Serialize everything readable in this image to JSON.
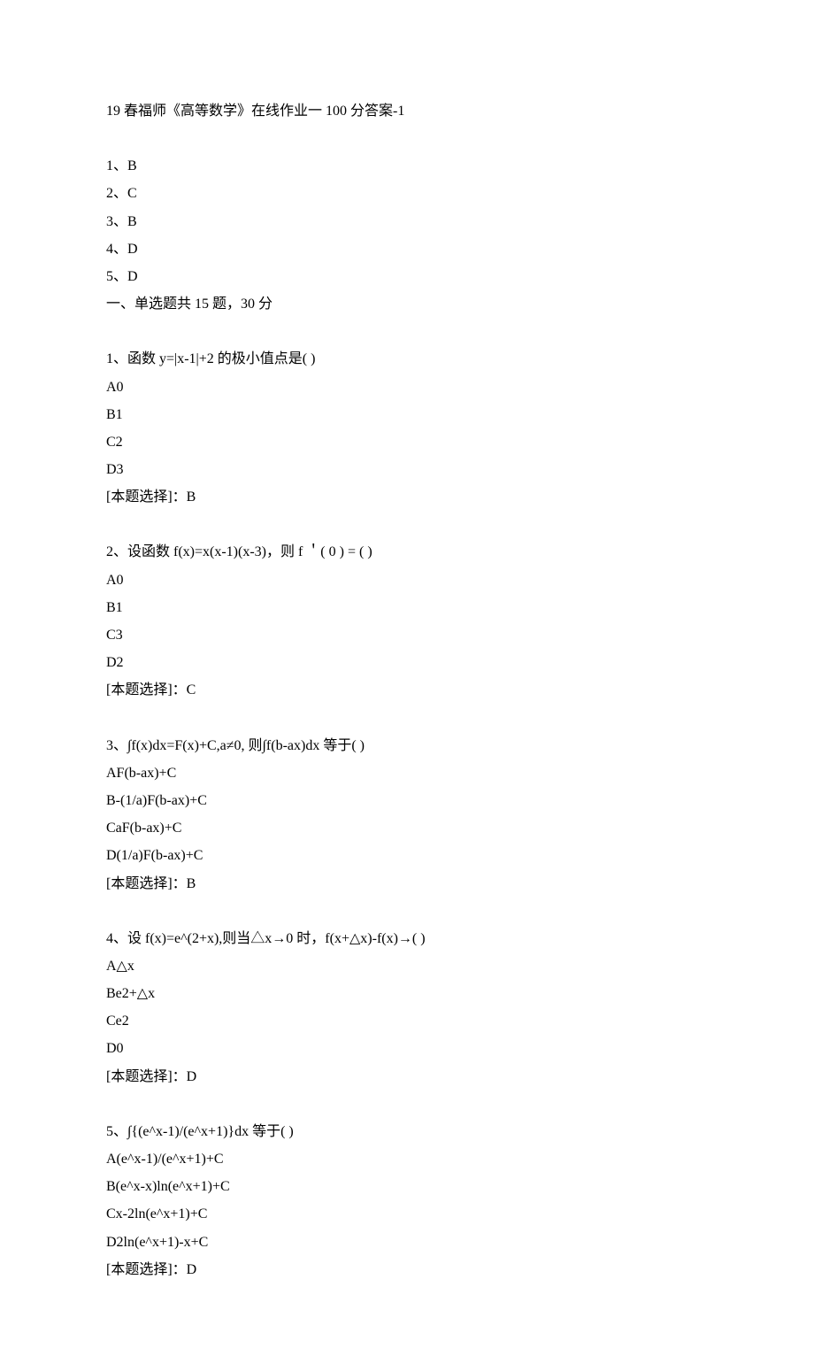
{
  "title": "19 春福师《高等数学》在线作业一 100 分答案-1",
  "answerKey": [
    "1、B",
    "2、C",
    "3、B",
    "4、D",
    "5、D"
  ],
  "sectionHeader": "一、单选题共 15 题，30 分",
  "questions": [
    {
      "prompt": "1、函数 y=|x-1|+2 的极小值点是( )",
      "options": [
        "A0",
        "B1",
        "C2",
        "D3"
      ],
      "answer": "[本题选择]：B"
    },
    {
      "prompt": "2、设函数 f(x)=x(x-1)(x-3)，则 f ＇( 0 ) = ( )",
      "options": [
        "A0",
        "B1",
        "C3",
        "D2"
      ],
      "answer": "[本题选择]：C"
    },
    {
      "prompt": "3、∫f(x)dx=F(x)+C,a≠0, 则∫f(b-ax)dx 等于( )",
      "options": [
        "AF(b-ax)+C",
        "B-(1/a)F(b-ax)+C",
        "CaF(b-ax)+C",
        "D(1/a)F(b-ax)+C"
      ],
      "answer": "[本题选择]：B"
    },
    {
      "prompt": "4、设 f(x)=e^(2+x),则当△x→0 时，f(x+△x)-f(x)→( )",
      "options": [
        "A△x",
        "Be2+△x",
        "Ce2",
        "D0"
      ],
      "answer": "[本题选择]：D"
    },
    {
      "prompt": "5、∫{(e^x-1)/(e^x+1)}dx 等于( )",
      "options": [
        "A(e^x-1)/(e^x+1)+C",
        "B(e^x-x)ln(e^x+1)+C",
        "Cx-2ln(e^x+1)+C",
        "D2ln(e^x+1)-x+C"
      ],
      "answer": "[本题选择]：D"
    }
  ]
}
